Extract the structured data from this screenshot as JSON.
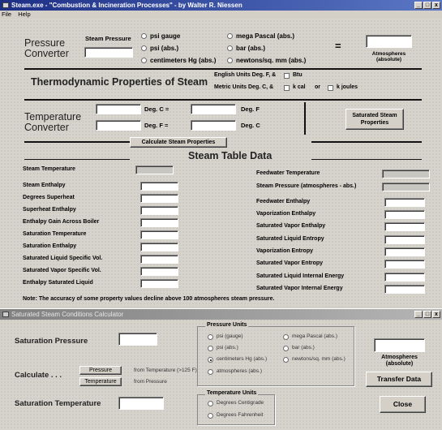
{
  "main_window": {
    "title": "Steam.exe - \"Combustion & Incineration Processes\" - by Walter R. Niessen",
    "menu": [
      "File",
      "Help"
    ]
  },
  "pressure_converter": {
    "title_line1": "Pressure",
    "title_line2": "Converter",
    "steam_pressure_label": "Steam Pressure",
    "units_left": [
      "psi gauge",
      "psi (abs.)",
      "centimeters Hg (abs.)"
    ],
    "units_right": [
      "mega Pascal (abs.)",
      "bar (abs.)",
      "newtons/sq. mm (abs.)"
    ],
    "equals": "=",
    "result_label_1": "Atmospheres",
    "result_label_2": "(absolute)"
  },
  "thermo": {
    "title": "Thermodynamic Properties of Steam",
    "english_units": "English Units   Deg. F, &",
    "btu": "Btu",
    "metric_units": "Metric Units   Deg. C, &",
    "kcal": "k cal",
    "or": "or",
    "kjoules": "k joules"
  },
  "temperature_converter": {
    "title_line1": "Temperature",
    "title_line2": "Converter",
    "deg_c_eq": "Deg. C =",
    "deg_f": "Deg. F",
    "deg_f_eq": "Deg. F =",
    "deg_c": "Deg. C",
    "saturated_button": "Saturated Steam Properties"
  },
  "calculate_button": "Calculate Steam Properties",
  "steam_table": {
    "title": "Steam Table Data",
    "left_rows": [
      "Steam Temperature",
      "Steam Enthalpy",
      "Degrees Superheat",
      "Superheat Enthalpy",
      "Enthalpy Gain Across Boiler",
      "Saturation Temperature",
      "Saturation Enthalpy",
      "Saturated Liquid Specific Vol.",
      "Saturated Vapor Specific Vol.",
      "Enthalpy Saturated Liquid"
    ],
    "right_rows": [
      "Feedwater Temperature",
      "Steam Pressure (atmospheres - abs.)",
      "Feedwater Enthalpy",
      "Vaporization Enthalpy",
      "Saturated Vapor Enthalpy",
      "Saturated Liquid Entropy",
      "Vaporization Entropy",
      "Saturated Vapor Entropy",
      "Saturated Liquid Internal Energy",
      "Saturated Vapor Internal Energy"
    ],
    "note": "Note: The accuracy of some property values decline above 100 atmospheres steam pressure."
  },
  "calc_window": {
    "title": "Saturated Steam Conditions Calculator",
    "saturation_pressure": "Saturation Pressure",
    "calculate": "Calculate . . .",
    "pressure_button": "Pressure",
    "from_temperature": "from Temperature (>125 F)",
    "temperature_button": "Temperature",
    "from_pressure": "from Pressure",
    "saturation_temperature": "Saturation Temperature",
    "pressure_units_title": "Pressure Units",
    "pu_left": [
      "psi (gauge)",
      "psi (abs.)",
      "centimeters Hg (abs.)",
      "atmospheres (abs.)"
    ],
    "pu_right": [
      "mega Pascal (abs.)",
      "bar (abs.)",
      "newtons/sq. mm (abs.)"
    ],
    "temperature_units_title": "Temperature Units",
    "tu": [
      "Degrees Centigrade",
      "Degrees Fahrenheit"
    ],
    "atm_1": "Atmospheres",
    "atm_2": "(absolute)",
    "transfer_button": "Transfer Data",
    "close_button": "Close"
  }
}
